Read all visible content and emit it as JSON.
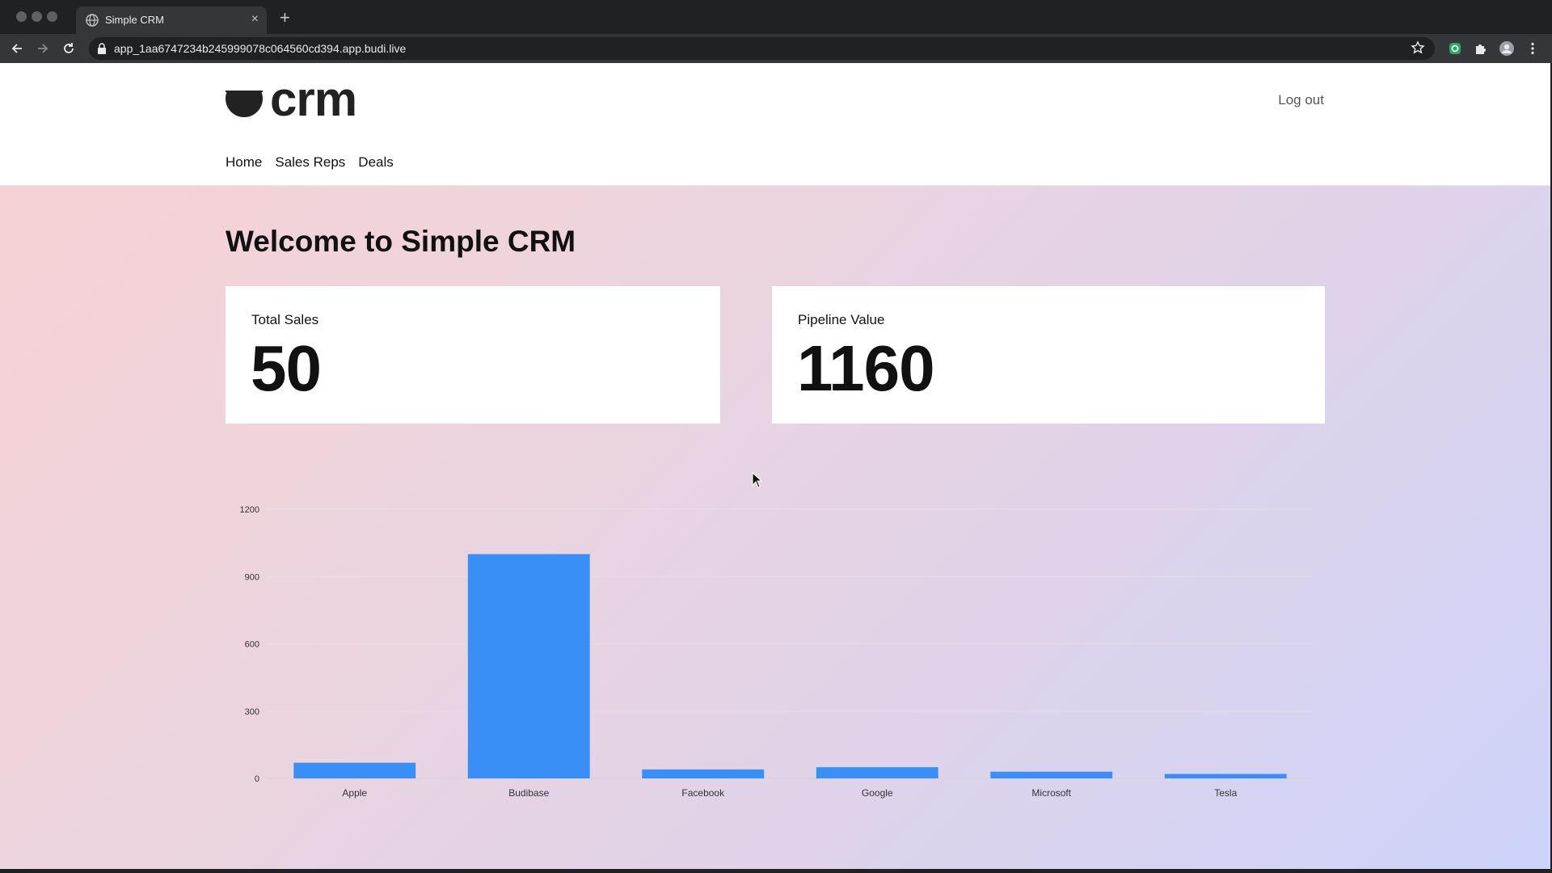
{
  "browser": {
    "tab_title": "Simple CRM",
    "tab_close": "×",
    "new_tab": "+",
    "url": "app_1aa6747234b245999078c064560cd394.app.budi.live"
  },
  "header": {
    "logo_text": "crm",
    "logout_label": "Log out",
    "nav": [
      "Home",
      "Sales Reps",
      "Deals"
    ]
  },
  "main": {
    "welcome": "Welcome to Simple CRM",
    "cards": [
      {
        "label": "Total Sales",
        "value": "50"
      },
      {
        "label": "Pipeline Value",
        "value": "1160"
      }
    ]
  },
  "colors": {
    "bar": "#3a8ff7",
    "gradient_start": "#f7d1d3",
    "gradient_end": "#cdd3fa"
  },
  "chart_data": {
    "type": "bar",
    "categories": [
      "Apple",
      "Budibase",
      "Facebook",
      "Google",
      "Microsoft",
      "Tesla"
    ],
    "values": [
      70,
      1000,
      40,
      50,
      30,
      20
    ],
    "yticks": [
      0,
      300,
      600,
      900,
      1200
    ],
    "ylim": [
      0,
      1200
    ],
    "xlabel": "",
    "ylabel": "",
    "grid": true
  }
}
